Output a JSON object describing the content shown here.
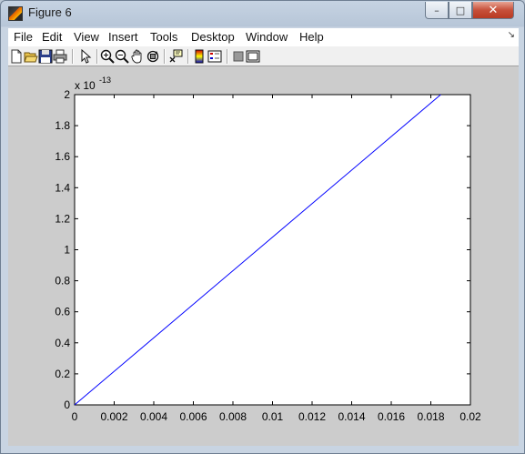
{
  "window": {
    "title": "Figure 6",
    "controls": {
      "minimize": "–",
      "maximize": "□",
      "close": "✕"
    }
  },
  "menu": {
    "items": [
      "File",
      "Edit",
      "View",
      "Insert",
      "Tools",
      "Desktop",
      "Window",
      "Help"
    ],
    "corner": "↘"
  },
  "toolbar": {
    "icons": [
      "new-figure-icon",
      "open-file-icon",
      "save-icon",
      "print-icon",
      "edit-plot-arrow-icon",
      "zoom-in-icon",
      "zoom-out-icon",
      "pan-hand-icon",
      "rotate-3d-icon",
      "data-cursor-icon",
      "insert-colorbar-icon",
      "insert-legend-icon",
      "hide-plot-tools-icon",
      "show-plot-tools-icon"
    ]
  },
  "chart_data": {
    "type": "line",
    "title": "",
    "xlabel": "",
    "ylabel": "",
    "xlim": [
      0,
      0.02
    ],
    "ylim": [
      0,
      2
    ],
    "xticks": [
      "0",
      "0.002",
      "0.004",
      "0.006",
      "0.008",
      "0.01",
      "0.012",
      "0.014",
      "0.016",
      "0.018",
      "0.02"
    ],
    "yticks": [
      "0",
      "0.2",
      "0.4",
      "0.6",
      "0.8",
      "1",
      "1.2",
      "1.4",
      "1.6",
      "1.8",
      "2"
    ],
    "y_multiplier": {
      "base": "x 10",
      "exponent": "-13"
    },
    "grid": false,
    "series": [
      {
        "color": "#0000ff",
        "x": [
          0,
          0.0185
        ],
        "y": [
          0,
          2
        ]
      }
    ]
  }
}
